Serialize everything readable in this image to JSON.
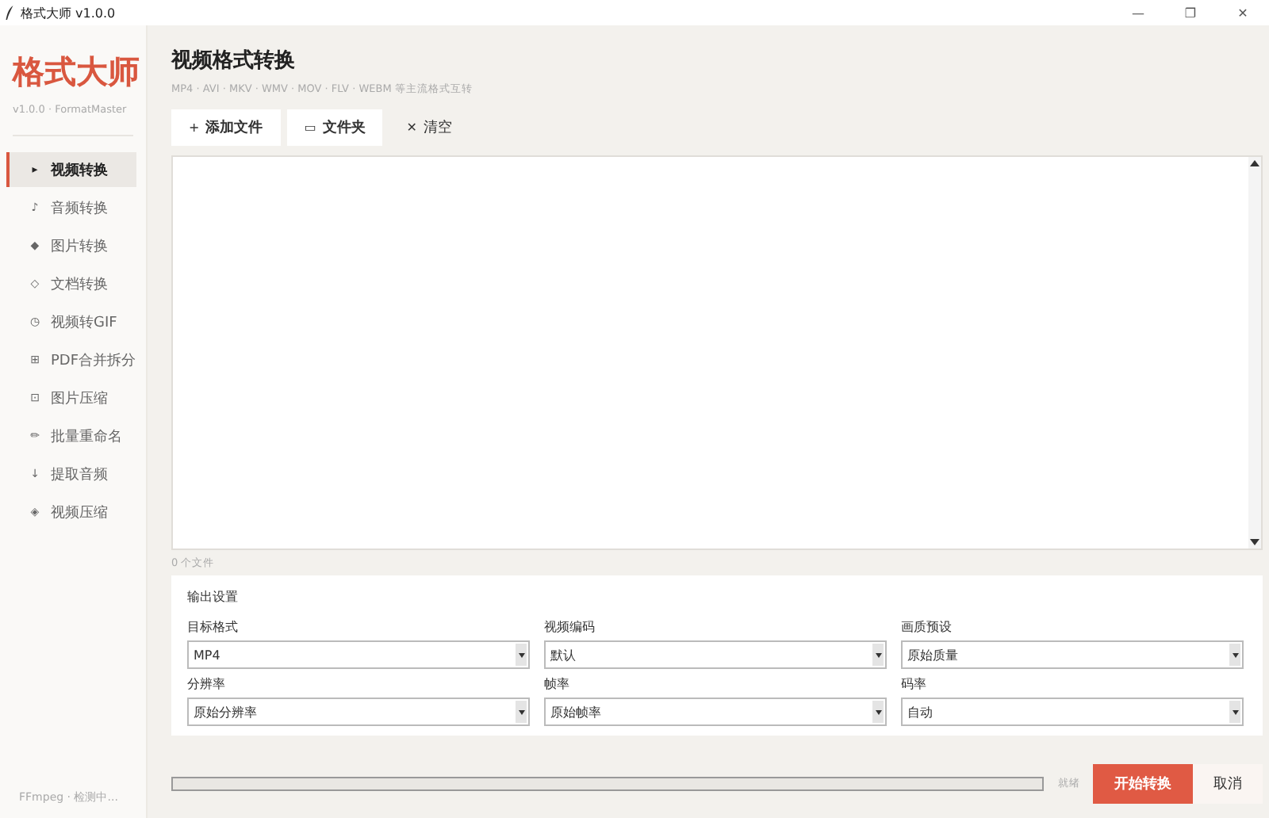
{
  "window": {
    "title": "格式大师 v1.0.0",
    "controls": [
      "—",
      "❐",
      "✕"
    ]
  },
  "sidebar": {
    "logo": "格式大师",
    "version": "v1.0.0 · FormatMaster",
    "items": [
      {
        "icon": "▸",
        "label": "视频转换",
        "selected": true
      },
      {
        "icon": "♪",
        "label": "音频转换",
        "selected": false
      },
      {
        "icon": "◆",
        "label": "图片转换",
        "selected": false
      },
      {
        "icon": "◇",
        "label": "文档转换",
        "selected": false
      },
      {
        "icon": "◷",
        "label": "视频转GIF",
        "selected": false
      },
      {
        "icon": "⊞",
        "label": "PDF合并拆分",
        "selected": false
      },
      {
        "icon": "⊡",
        "label": "图片压缩",
        "selected": false
      },
      {
        "icon": "✏",
        "label": "批量重命名",
        "selected": false
      },
      {
        "icon": "↓",
        "label": "提取音频",
        "selected": false
      },
      {
        "icon": "◈",
        "label": "视频压缩",
        "selected": false
      }
    ],
    "status": "FFmpeg · 检测中..."
  },
  "page": {
    "title": "视频格式转换",
    "subtitle": "MP4 · AVI · MKV · WMV · MOV · FLV · WEBM 等主流格式互转"
  },
  "toolbar": [
    {
      "icon": "+",
      "label": "添加文件",
      "kind": "filled"
    },
    {
      "icon": "▭",
      "label": "文件夹",
      "kind": "filled"
    },
    {
      "icon": "✕",
      "label": "清空",
      "kind": "plain"
    }
  ],
  "file_count": "0 个文件",
  "settings": {
    "title": "输出设置",
    "fields": [
      {
        "label": "目标格式",
        "value": "MP4"
      },
      {
        "label": "视频编码",
        "value": "默认"
      },
      {
        "label": "画质预设",
        "value": "原始质量"
      },
      {
        "label": "分辨率",
        "value": "原始分辨率"
      },
      {
        "label": "帧率",
        "value": "原始帧率"
      },
      {
        "label": "码率",
        "value": "自动"
      }
    ]
  },
  "progress": {
    "level": 0,
    "status": "就绪"
  },
  "buttons": [
    {
      "label": "开始转换",
      "kind": "primary"
    },
    {
      "label": "取消",
      "kind": "secondary"
    }
  ]
}
